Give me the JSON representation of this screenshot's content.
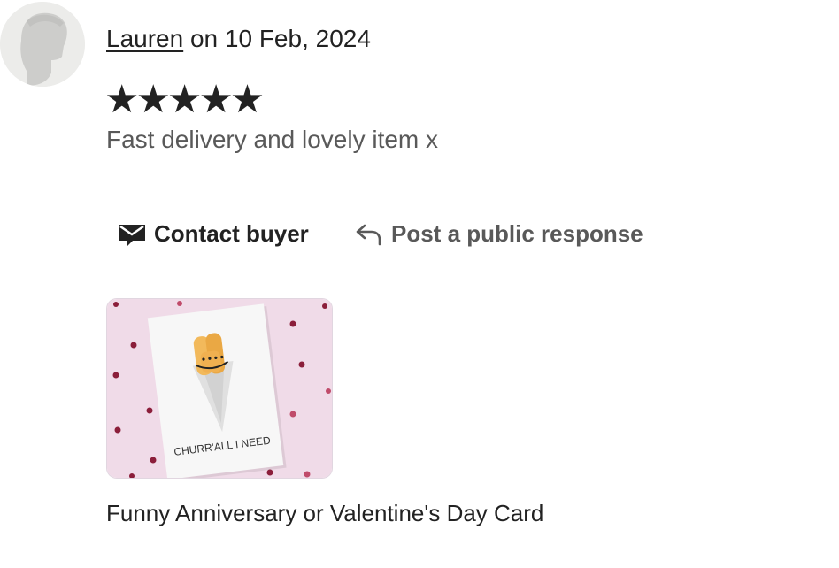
{
  "review": {
    "author": "Lauren",
    "date_text": " on 10 Feb, 2024",
    "rating": 5,
    "stars_text": "★★★★★",
    "text": "Fast delivery and lovely item x"
  },
  "actions": {
    "contact_label": "Contact buyer",
    "respond_label": "Post a public response"
  },
  "item": {
    "card_text": "CHURR'ALL I NEED",
    "title": "Funny Anniversary or Valentine's Day Card"
  },
  "colors": {
    "text_primary": "#222222",
    "text_secondary": "#595959",
    "card_background": "#f0dbe8",
    "heart": "#8b1e3a"
  }
}
